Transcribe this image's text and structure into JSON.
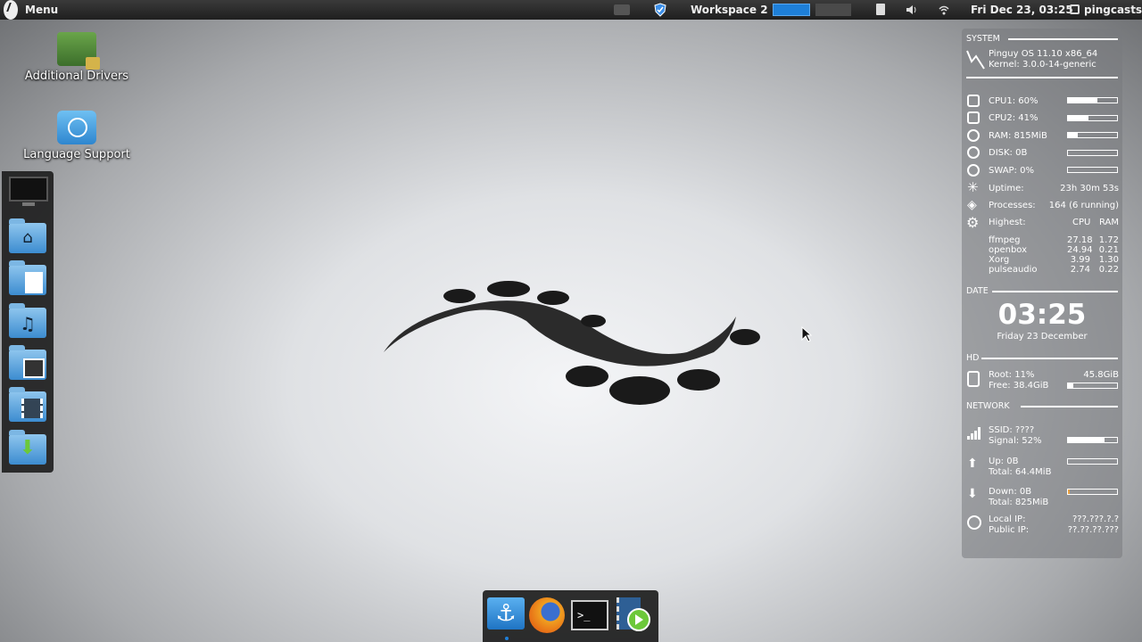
{
  "panel": {
    "menu_label": "Menu",
    "workspace_label": "Workspace 2",
    "datetime": "Fri Dec 23, 03:25",
    "user": "pingcasts"
  },
  "desktop": {
    "icons": [
      {
        "label": "Additional Drivers",
        "icon": "drivers-icon"
      },
      {
        "label": "Language Support",
        "icon": "language-icon"
      }
    ]
  },
  "left_dock": {
    "items": [
      "monitor-icon",
      "home-folder-icon",
      "documents-folder-icon",
      "music-folder-icon",
      "pictures-folder-icon",
      "videos-folder-icon",
      "downloads-folder-icon"
    ]
  },
  "conky": {
    "system": {
      "header": "SYSTEM",
      "os": "Pinguy OS 11.10 x86_64",
      "kernel": "Kernel: 3.0.0-14-generic"
    },
    "stats": [
      {
        "label": "CPU1: 60%",
        "bar": 0.6
      },
      {
        "label": "CPU2: 41%",
        "bar": 0.41
      },
      {
        "label": "RAM: 815MiB",
        "bar": 0.2
      },
      {
        "label": "DISK: 0B",
        "bar": 0.0
      },
      {
        "label": "SWAP: 0%",
        "bar": 0.0
      }
    ],
    "uptime_label": "Uptime:",
    "uptime_value": "23h 30m 53s",
    "processes_label": "Processes:",
    "processes_value": "164 (6 running)",
    "highest": {
      "label": "Highest:",
      "col_cpu": "CPU",
      "col_ram": "RAM",
      "rows": [
        {
          "name": "ffmpeg",
          "cpu": "27.18",
          "ram": "1.72"
        },
        {
          "name": "openbox",
          "cpu": "24.94",
          "ram": "0.21"
        },
        {
          "name": "Xorg",
          "cpu": "3.99",
          "ram": "1.30"
        },
        {
          "name": "pulseaudio",
          "cpu": "2.74",
          "ram": "0.22"
        }
      ]
    },
    "date": {
      "header": "DATE",
      "time": "03:25",
      "day": "Friday 23 December"
    },
    "hd": {
      "header": "HD",
      "root": "Root: 11%",
      "size": "45.8GiB",
      "free": "Free: 38.4GiB",
      "bar": 0.11
    },
    "network": {
      "header": "NETWORK",
      "ssid": "SSID: ????",
      "signal": "Signal: 52%",
      "signal_bar": 0.75,
      "up": "Up: 0B",
      "up_total": "Total: 64.4MiB",
      "down": "Down: 0B",
      "down_total": "Total: 825MiB",
      "local_ip_label": "Local IP:",
      "local_ip": "???.???.?.?",
      "public_ip_label": "Public IP:",
      "public_ip": "??.??.??.???"
    }
  },
  "bottom_dock": {
    "items": [
      "anchor-icon",
      "firefox-icon",
      "terminal-icon",
      "media-player-icon"
    ]
  },
  "colors": {
    "accent": "#1e7fd8",
    "panel": "#2a2a2a"
  }
}
